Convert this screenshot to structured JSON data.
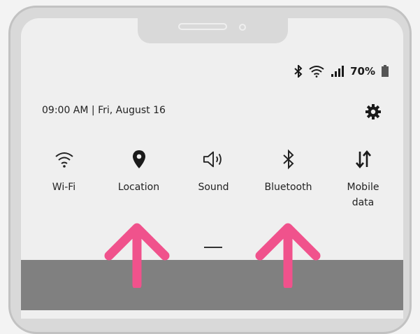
{
  "status_bar": {
    "icons": [
      "bluetooth-icon",
      "wifi-icon",
      "signal-icon",
      "battery-icon"
    ],
    "battery_percent": "70%"
  },
  "panel": {
    "datetime": "09:00 AM | Fri, August 16",
    "settings_icon": "gear-icon"
  },
  "tiles": [
    {
      "label": "Wi-Fi",
      "icon": "wifi-icon"
    },
    {
      "label": "Location",
      "icon": "location-pin-icon"
    },
    {
      "label": "Sound",
      "icon": "speaker-icon"
    },
    {
      "label": "Bluetooth",
      "icon": "bluetooth-icon"
    },
    {
      "label": "Mobile\ndata",
      "icon": "data-arrows-icon"
    }
  ],
  "colors": {
    "arrow": "#f0528c",
    "bottom_panel": "#808080",
    "screen": "#efefef",
    "frame": "#d9d9d9"
  }
}
